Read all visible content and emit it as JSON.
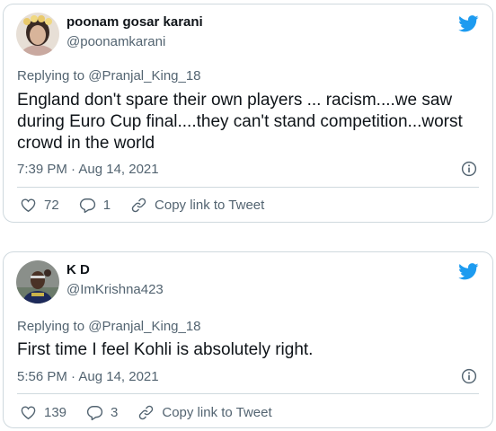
{
  "tweets": [
    {
      "display_name": "poonam gosar karani",
      "handle": "@poonamkarani",
      "replying_prefix": "Replying to ",
      "replying_to": "@Pranjal_King_18",
      "text": "England don't spare their own players ... racism....we saw during Euro Cup final....they can't stand competition...worst crowd in the world",
      "timestamp": "7:39 PM · Aug 14, 2021",
      "likes": "72",
      "replies": "1",
      "copy_link_label": "Copy link to Tweet"
    },
    {
      "display_name": "K D",
      "handle": "@ImKrishna423",
      "replying_prefix": "Replying to ",
      "replying_to": "@Pranjal_King_18",
      "text": "First time I feel Kohli is absolutely right.",
      "timestamp": "5:56 PM · Aug 14, 2021",
      "likes": "139",
      "replies": "3",
      "copy_link_label": "Copy link to Tweet"
    }
  ],
  "colors": {
    "brand": "#1d9bf0",
    "text": "#0f1419",
    "secondary": "#536471",
    "border": "#cfd9de"
  },
  "icons": [
    "twitter-bird-icon",
    "info-icon",
    "heart-icon",
    "reply-icon",
    "link-icon"
  ]
}
